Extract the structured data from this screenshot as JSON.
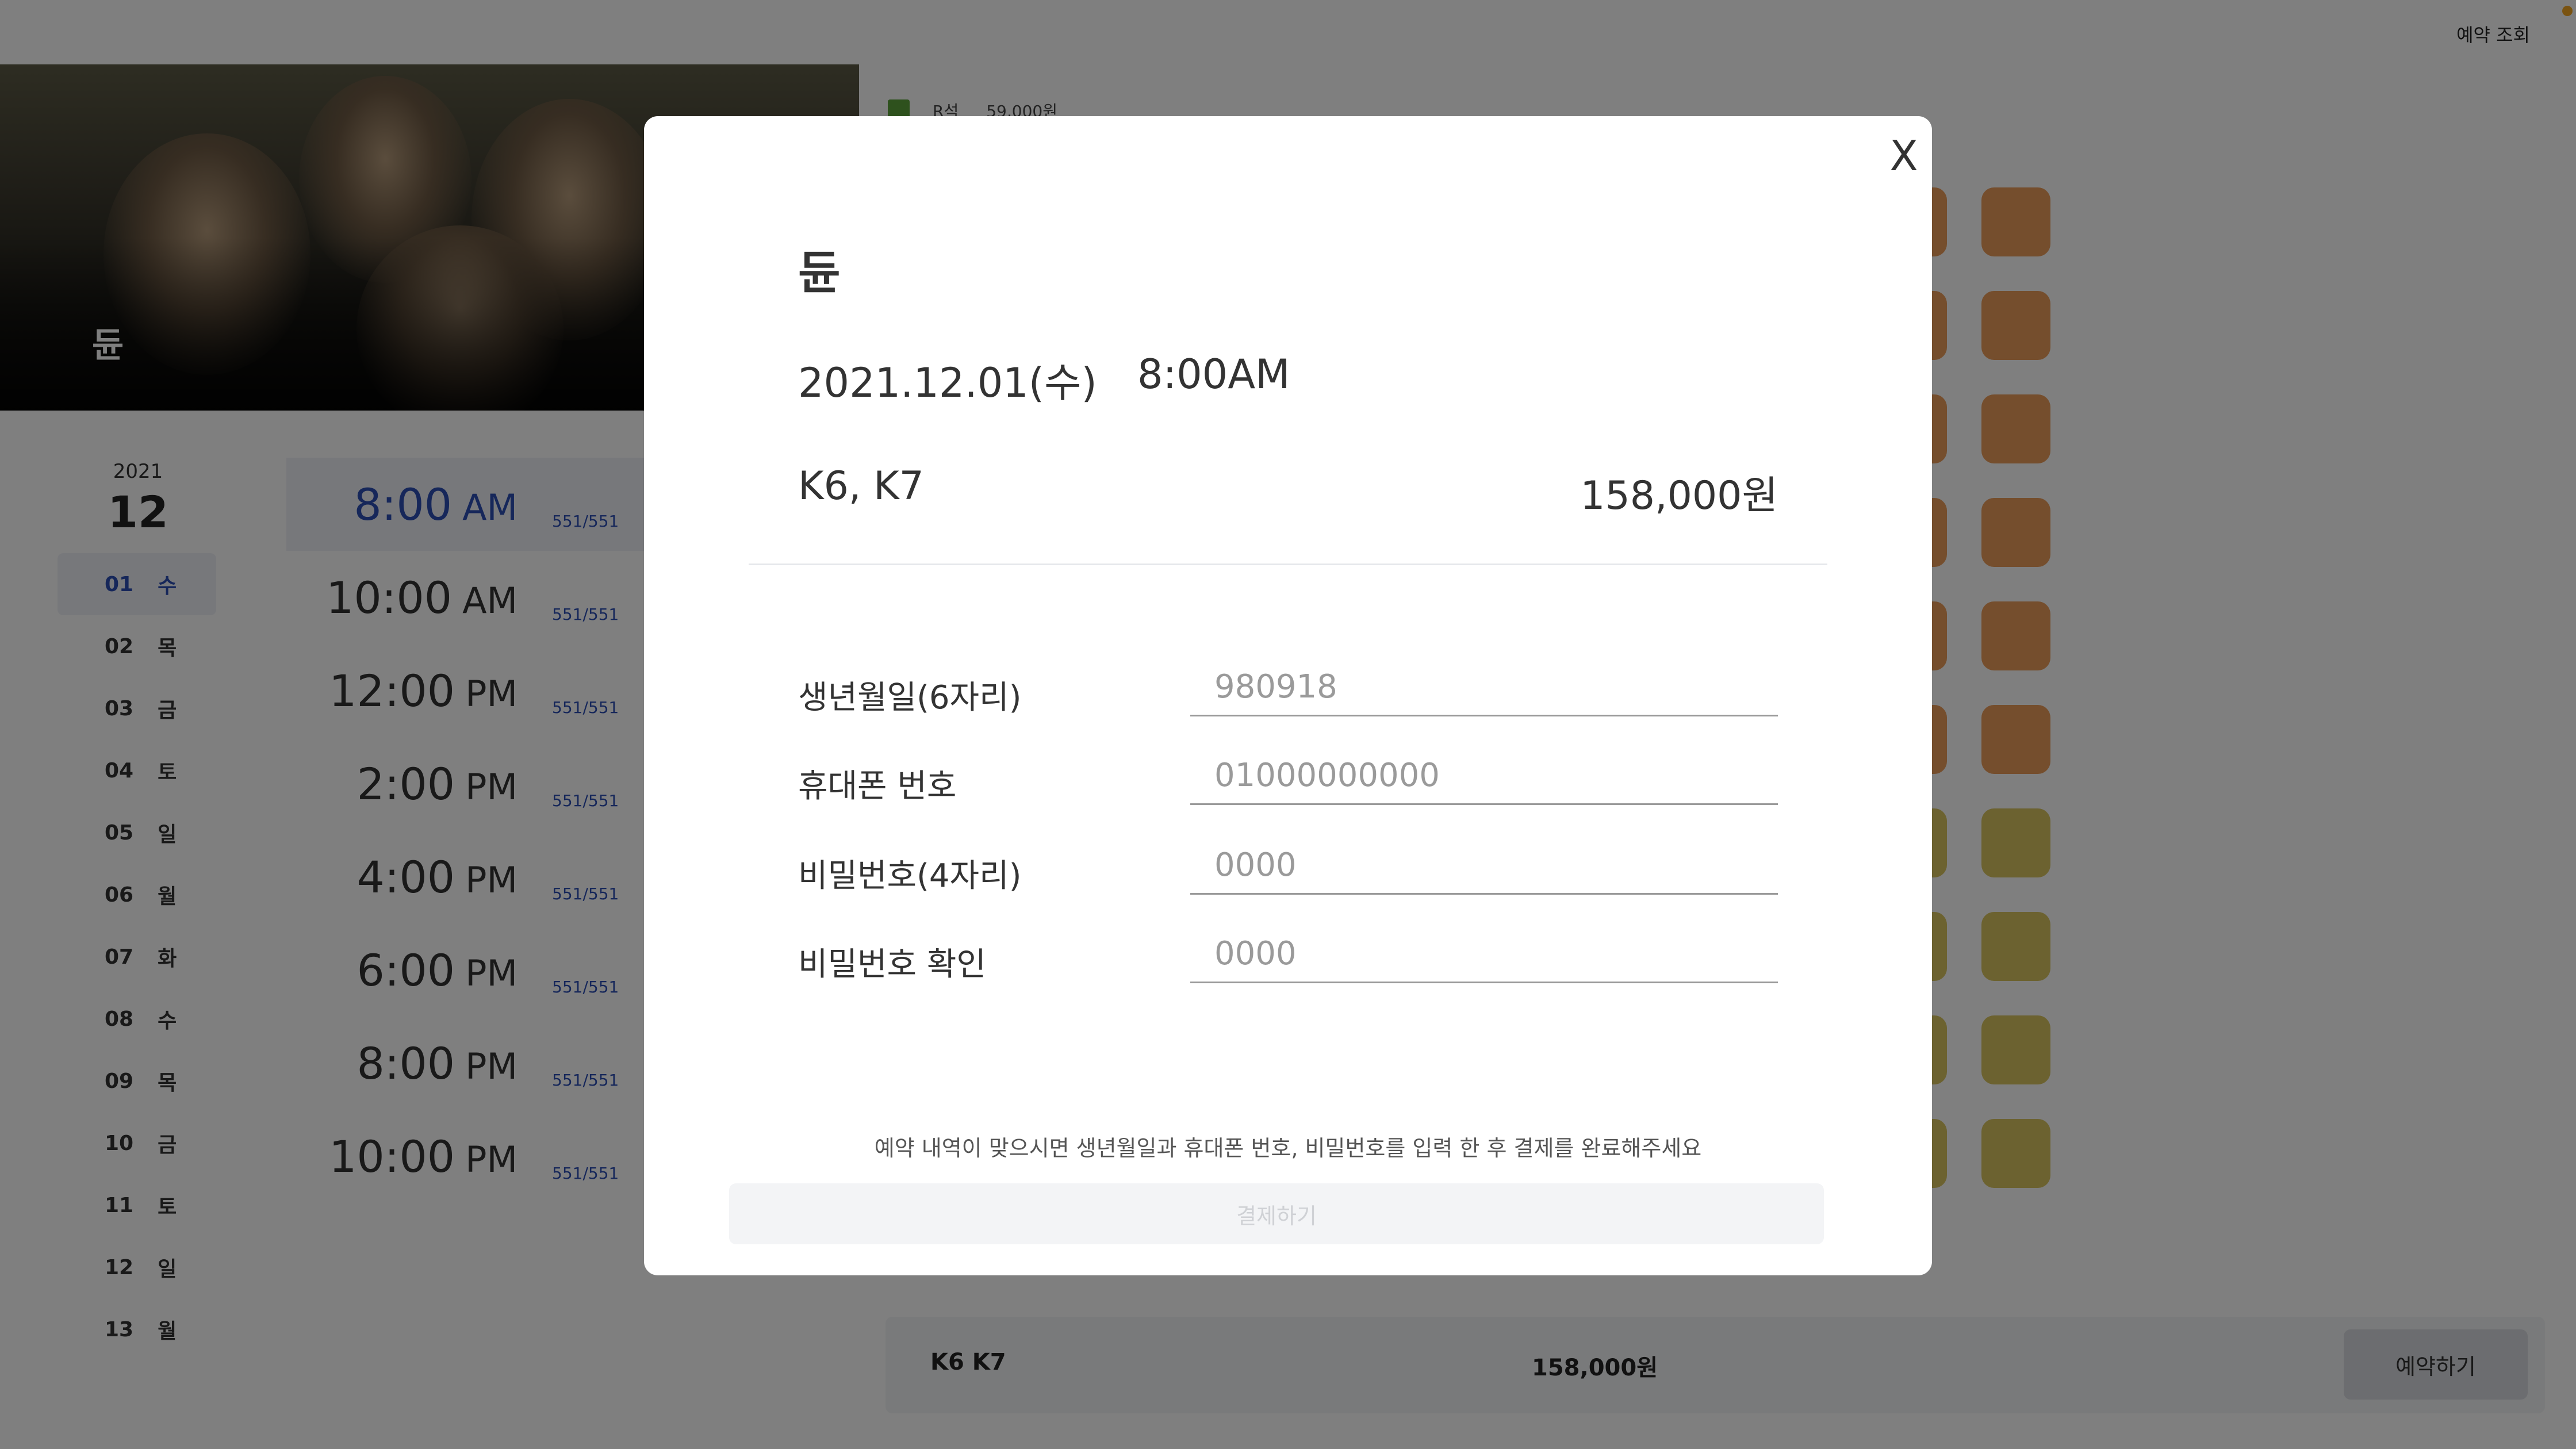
{
  "header": {
    "lookup_label": "예약 조회"
  },
  "movie": {
    "title": "듄"
  },
  "calendar": {
    "year": "2021",
    "month": "12",
    "days": [
      {
        "num": "01",
        "weekday": "수",
        "active": true
      },
      {
        "num": "02",
        "weekday": "목"
      },
      {
        "num": "03",
        "weekday": "금"
      },
      {
        "num": "04",
        "weekday": "토"
      },
      {
        "num": "05",
        "weekday": "일"
      },
      {
        "num": "06",
        "weekday": "월"
      },
      {
        "num": "07",
        "weekday": "화"
      },
      {
        "num": "08",
        "weekday": "수"
      },
      {
        "num": "09",
        "weekday": "목"
      },
      {
        "num": "10",
        "weekday": "금"
      },
      {
        "num": "11",
        "weekday": "토"
      },
      {
        "num": "12",
        "weekday": "일"
      },
      {
        "num": "13",
        "weekday": "월"
      }
    ]
  },
  "showtimes": [
    {
      "time": "8:00",
      "ampm": "AM",
      "seats": "551/551",
      "active": true
    },
    {
      "time": "10:00",
      "ampm": "AM",
      "seats": "551/551"
    },
    {
      "time": "12:00",
      "ampm": "PM",
      "seats": "551/551"
    },
    {
      "time": "2:00",
      "ampm": "PM",
      "seats": "551/551"
    },
    {
      "time": "4:00",
      "ampm": "PM",
      "seats": "551/551"
    },
    {
      "time": "6:00",
      "ampm": "PM",
      "seats": "551/551"
    },
    {
      "time": "8:00",
      "ampm": "PM",
      "seats": "551/551"
    },
    {
      "time": "10:00",
      "ampm": "PM",
      "seats": "551/551"
    }
  ],
  "legend": {
    "grade": "R석",
    "price": "59,000원",
    "color": "#5da33a"
  },
  "seat_colors": {
    "r": "#ea9c5a",
    "y": "#d8c461"
  },
  "booking_bar": {
    "seats": "K6  K7",
    "price": "158,000원",
    "button_label": "예약하기"
  },
  "modal": {
    "close_label": "X",
    "title": "듄",
    "date": "2021.12.01(수)",
    "time": "8:00AM",
    "seats": "K6, K7",
    "price": "158,000원",
    "fields": {
      "birth": {
        "label": "생년월일(6자리)",
        "placeholder": "980918"
      },
      "phone": {
        "label": "휴대폰 번호",
        "placeholder": "01000000000"
      },
      "password": {
        "label": "비밀번호(4자리)",
        "placeholder": "0000"
      },
      "password_confirm": {
        "label": "비밀번호 확인",
        "placeholder": "0000"
      }
    },
    "notice": "예약 내역이 맞으시면 생년월일과 휴대폰 번호, 비밀번호를 입력 한 후 결제를 완료해주세요",
    "pay_label": "결제하기"
  }
}
